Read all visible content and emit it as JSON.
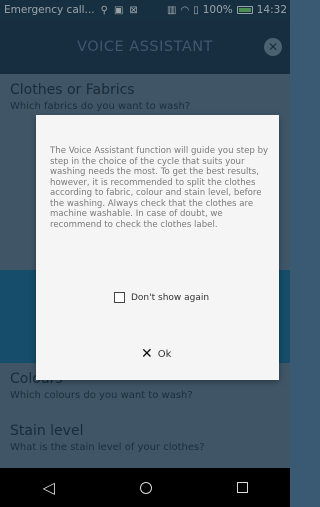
{
  "status_bar": {
    "notification": "Emergency call...",
    "battery": "100%",
    "time": "14:32",
    "icons": [
      "usb-icon",
      "image-icon",
      "screenshot-icon",
      "vibrate-icon",
      "wifi-icon",
      "sim-icon",
      "battery-icon"
    ]
  },
  "app_bar": {
    "title": "VOICE ASSISTANT",
    "close_icon": "close-icon"
  },
  "sections": [
    {
      "title": "Clothes or Fabrics",
      "subtitle": "Which fabrics do you want to wash?"
    },
    {
      "title": "Colours",
      "subtitle": "Which colours do you want to wash?"
    },
    {
      "title": "Stain level",
      "subtitle": "What is the stain level of your clothes?"
    }
  ],
  "dialog": {
    "message": "The Voice Assistant function will guide you step by step in the choice of the cycle that suits your washing needs the most. To get the best results, however, it is recommended to split the clothes according to fabric, colour and stain level, before the washing. Always check that the clothes are machine washable. In case of doubt, we recommend to check the clothes label.",
    "checkbox_label": "Don't show again",
    "checkbox_checked": false,
    "ok_label": "Ok"
  },
  "nav_bar": {
    "back": "back-icon",
    "home": "home-icon",
    "recents": "recents-icon"
  },
  "colors": {
    "status_bar": "#1f3f55",
    "app_bar": "#1e3c52",
    "section_light": "#5e7a90",
    "section_blue": "#1e6c94",
    "dialog_bg": "#f5f5f5"
  }
}
